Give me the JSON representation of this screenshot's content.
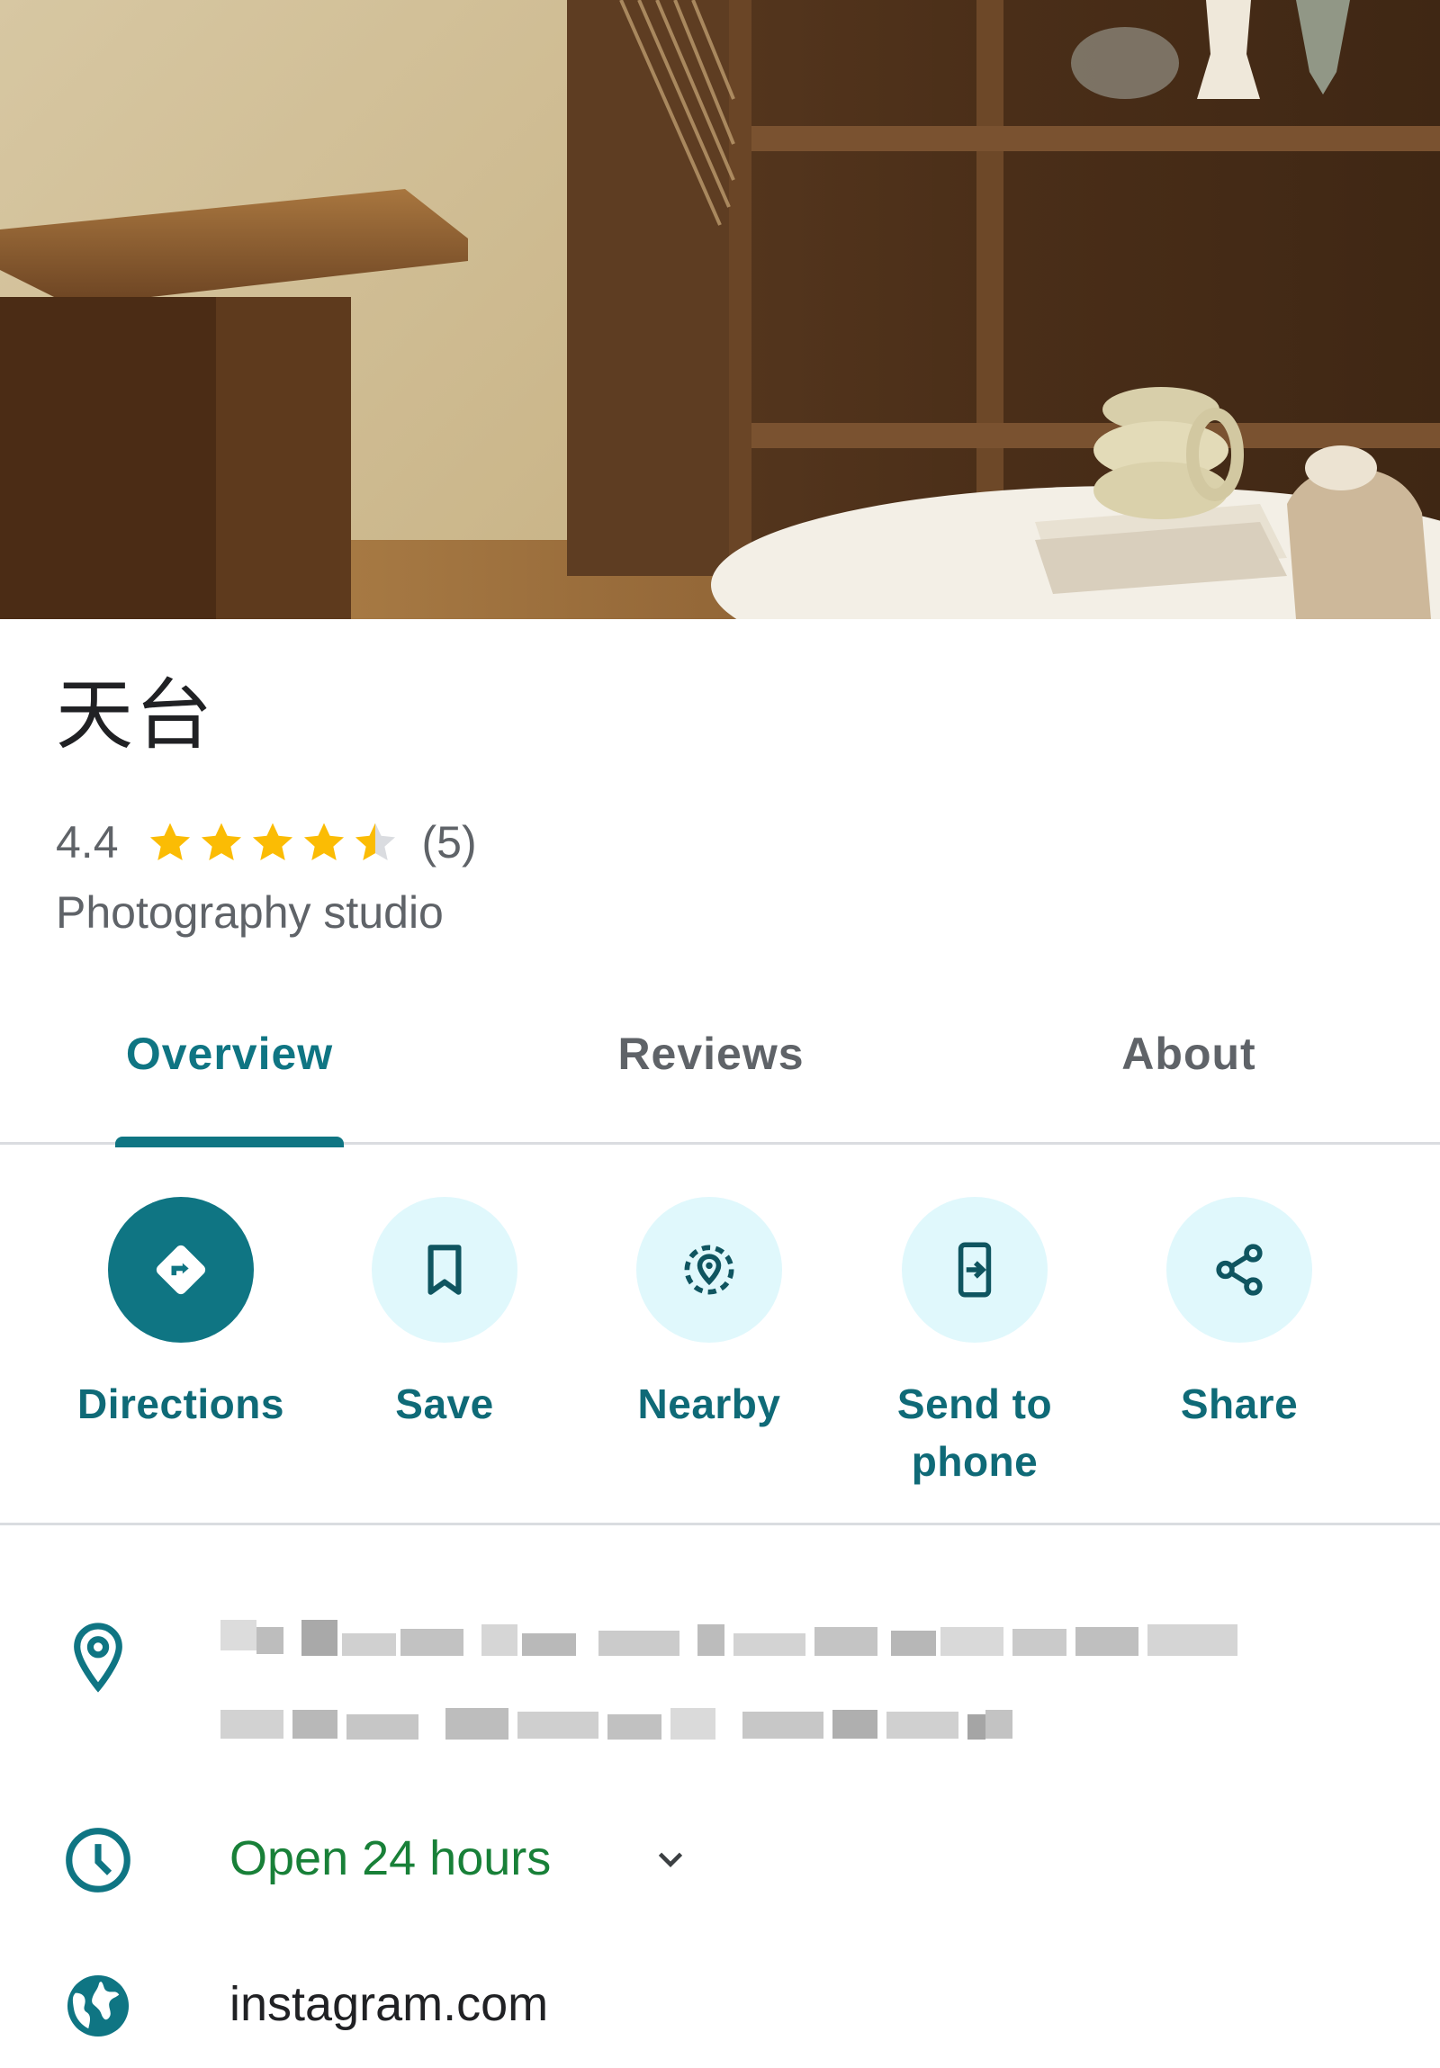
{
  "place": {
    "name": "天台",
    "rating": "4.4",
    "stars": 4.4,
    "review_count": "(5)",
    "category": "Photography studio"
  },
  "tabs": [
    {
      "label": "Overview",
      "active": true
    },
    {
      "label": "Reviews",
      "active": false
    },
    {
      "label": "About",
      "active": false
    }
  ],
  "actions": {
    "directions": {
      "label": "Directions",
      "icon": "directions-icon"
    },
    "save": {
      "label": "Save",
      "icon": "bookmark-icon"
    },
    "nearby": {
      "label": "Nearby",
      "icon": "nearby-icon"
    },
    "send_to_phone": {
      "label": "Send to phone",
      "line1": "Send to",
      "line2": "phone",
      "icon": "send-to-phone-icon"
    },
    "share": {
      "label": "Share",
      "icon": "share-icon"
    }
  },
  "info": {
    "address_icon": "location-pin-icon",
    "hours": "Open 24 hours",
    "hours_icon": "clock-icon",
    "website": "instagram.com",
    "website_icon": "globe-icon"
  },
  "colors": {
    "accent": "#0f7583",
    "action_bg": "#e0f8fc",
    "open_green": "#188038",
    "star": "#fbbc04"
  }
}
